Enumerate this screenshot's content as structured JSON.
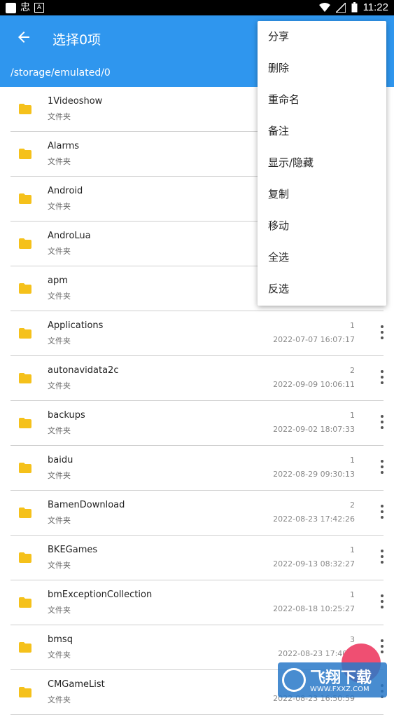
{
  "status_bar": {
    "time": "11:22",
    "left_glyph": "忠",
    "left_badge": "A"
  },
  "app_bar": {
    "title": "选择0项",
    "path": "/storage/emulated/0"
  },
  "menu": {
    "items": [
      "分享",
      "删除",
      "重命名",
      "备注",
      "显示/隐藏",
      "复制",
      "移动",
      "全选",
      "反选"
    ]
  },
  "files": [
    {
      "name": "1Videoshow",
      "type": "文件夹",
      "count": "",
      "date": ""
    },
    {
      "name": "Alarms",
      "type": "文件夹",
      "count": "",
      "date": ""
    },
    {
      "name": "Android",
      "type": "文件夹",
      "count": "",
      "date": ""
    },
    {
      "name": "AndroLua",
      "type": "文件夹",
      "count": "",
      "date": ""
    },
    {
      "name": "apm",
      "type": "文件夹",
      "count": "",
      "date": ""
    },
    {
      "name": "Applications",
      "type": "文件夹",
      "count": "1",
      "date": "2022-07-07 16:07:17"
    },
    {
      "name": "autonavidata2c",
      "type": "文件夹",
      "count": "2",
      "date": "2022-09-09 10:06:11"
    },
    {
      "name": "backups",
      "type": "文件夹",
      "count": "1",
      "date": "2022-09-02 18:07:33"
    },
    {
      "name": "baidu",
      "type": "文件夹",
      "count": "1",
      "date": "2022-08-29 09:30:13"
    },
    {
      "name": "BamenDownload",
      "type": "文件夹",
      "count": "2",
      "date": "2022-08-23 17:42:26"
    },
    {
      "name": "BKEGames",
      "type": "文件夹",
      "count": "1",
      "date": "2022-09-13 08:32:27"
    },
    {
      "name": "bmExceptionCollection",
      "type": "文件夹",
      "count": "1",
      "date": "2022-08-18 10:25:27"
    },
    {
      "name": "bmsq",
      "type": "文件夹",
      "count": "3",
      "date": "2022-08-23 17:40:2"
    },
    {
      "name": "CMGameList",
      "type": "文件夹",
      "count": "",
      "date": "2022-08-23 16:50:59"
    }
  ],
  "watermark": {
    "title": "飞翔下载",
    "url": "WWW.FXXZ.COM"
  },
  "colors": {
    "app_bar": "#2f96ee",
    "folder": "#f5c11b",
    "fab": "#ef4f72"
  }
}
